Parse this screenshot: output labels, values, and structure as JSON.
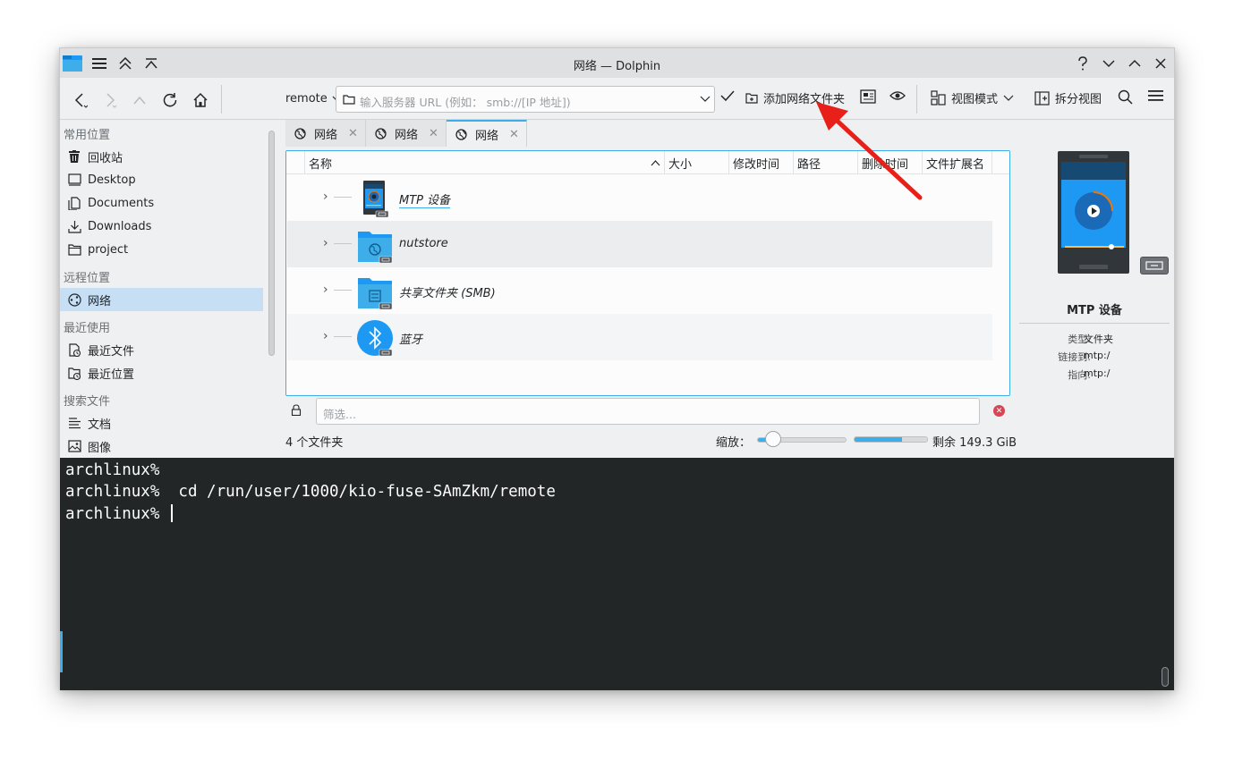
{
  "window": {
    "title": "网络 — Dolphin"
  },
  "toolbar": {
    "url_scheme": "remote",
    "url_placeholder": "输入服务器 URL (例如： smb://[IP 地址])",
    "add_network_folder": "添加网络文件夹",
    "view_mode": "视图模式",
    "split_view": "拆分视图"
  },
  "sidebar": {
    "sections": [
      {
        "label": "常用位置"
      },
      {
        "label": "远程位置"
      },
      {
        "label": "最近使用"
      },
      {
        "label": "搜索文件"
      }
    ],
    "places": [
      {
        "label": "回收站",
        "icon": "trash-icon"
      },
      {
        "label": "Desktop",
        "icon": "desktop-icon"
      },
      {
        "label": "Documents",
        "icon": "documents-icon"
      },
      {
        "label": "Downloads",
        "icon": "downloads-icon"
      },
      {
        "label": "project",
        "icon": "folder-icon"
      }
    ],
    "remote": [
      {
        "label": "网络",
        "icon": "network-icon",
        "active": true
      }
    ],
    "recent": [
      {
        "label": "最近文件",
        "icon": "recent-files-icon"
      },
      {
        "label": "最近位置",
        "icon": "recent-locations-icon"
      }
    ],
    "search": [
      {
        "label": "文档",
        "icon": "text-document-icon"
      },
      {
        "label": "图像",
        "icon": "image-icon"
      }
    ]
  },
  "tabs": [
    {
      "label": "网络",
      "active": false
    },
    {
      "label": "网络",
      "active": false
    },
    {
      "label": "网络",
      "active": true
    }
  ],
  "columns": [
    "名称",
    "大小",
    "修改时间",
    "路径",
    "删除时间",
    "文件扩展名"
  ],
  "files": [
    {
      "name": "MTP 设备",
      "icon": "mtp-device-icon"
    },
    {
      "name": "nutstore",
      "icon": "network-folder-icon"
    },
    {
      "name": "共享文件夹 (SMB)",
      "icon": "smb-share-icon"
    },
    {
      "name": "蓝牙",
      "icon": "bluetooth-icon"
    }
  ],
  "filter": {
    "placeholder": "筛选..."
  },
  "status": {
    "folder_count": "4 个文件夹",
    "zoom_label": "缩放：",
    "zoom_level": 0.18,
    "space_used_fraction": 0.66,
    "free_space": "剩余 149.3 GiB"
  },
  "info_panel": {
    "title": "MTP 设备",
    "rows": [
      {
        "key": "类型:",
        "value": "文件夹"
      },
      {
        "key": "链接到:",
        "value": "mtp:/"
      },
      {
        "key": "指向:",
        "value": "mtp:/"
      }
    ]
  },
  "terminal": {
    "lines": [
      "archlinux%",
      "archlinux%  cd /run/user/1000/kio-fuse-SAmZkm/remote",
      "archlinux% "
    ]
  },
  "colors": {
    "accent": "#3daee9",
    "selection": "#c6dff4",
    "terminal_bg": "#232627",
    "annotation_arrow": "#e8201a"
  }
}
